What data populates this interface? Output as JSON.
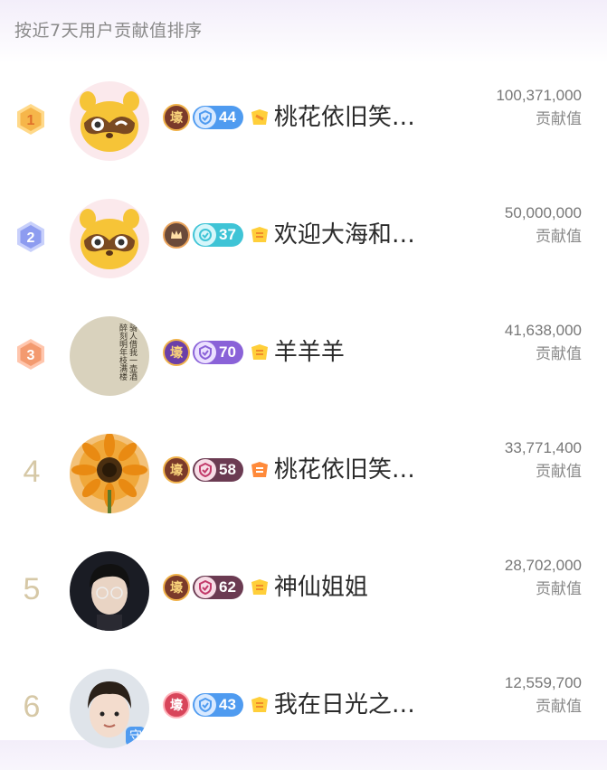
{
  "header": {
    "title": "按近7天用户贡献值排序"
  },
  "value_label": "贡献值",
  "rows": [
    {
      "rank": "1",
      "level": "44",
      "name": "桃花依旧笑…",
      "value": "100,371,000",
      "label": "贡献值"
    },
    {
      "rank": "2",
      "level": "37",
      "name": "欢迎大海和…",
      "value": "50,000,000",
      "label": "贡献值"
    },
    {
      "rank": "3",
      "level": "70",
      "name": "羊羊羊",
      "value": "41,638,000",
      "label": "贡献值"
    },
    {
      "rank": "4",
      "level": "58",
      "name": "桃花依旧笑…",
      "value": "33,771,400",
      "label": "贡献值"
    },
    {
      "rank": "5",
      "level": "62",
      "name": "神仙姐姐",
      "value": "28,702,000",
      "label": "贡献值"
    },
    {
      "rank": "6",
      "level": "43",
      "name": "我在日光之…",
      "value": "12,559,700",
      "label": "贡献值"
    }
  ],
  "avatar_text": {
    "calligraphy": "骑人借我一壶酒 醉刻明年枝满楼",
    "guard_badge": "守"
  },
  "noble_badge_text": "壕",
  "colors": {
    "gold_badge": "#f6b64a",
    "silver_badge": "#8d9cf0",
    "bronze_badge": "#f39a6f",
    "level_blue": "#4f9bf0",
    "level_teal": "#3fc4d6",
    "level_purple": "#8a62d8",
    "level_dark": "#6b3b52",
    "rank_plain": "#d6c8a6",
    "fan_gold": "#ffcf3a"
  }
}
